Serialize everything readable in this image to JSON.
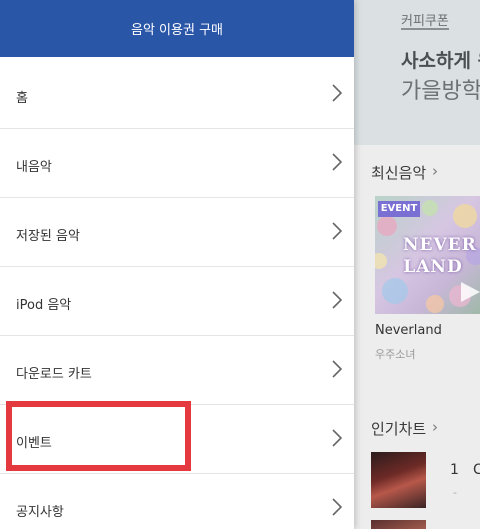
{
  "drawer": {
    "title": "음악 이용권 구매",
    "items": [
      {
        "label": "홈"
      },
      {
        "label": "내음악"
      },
      {
        "label": "저장된 음악"
      },
      {
        "label": "iPod 음악"
      },
      {
        "label": "다운로드 카트"
      },
      {
        "label": "이벤트"
      },
      {
        "label": "공지사항"
      }
    ],
    "highlighted_item": "이벤트",
    "highlight_color": "#e43a3f",
    "header_color": "#2a56a8"
  },
  "background": {
    "coupon_tab": "커피쿠폰",
    "promo_line1": "사소하게 윈",
    "promo_line2": "가을방학",
    "latest_section": "최신음악",
    "event_badge": "EVENT",
    "album_art_text": "NEVER LAND",
    "song_title": "Neverland",
    "song_artist": "우주소녀",
    "chart_section": "인기차트",
    "chart_rank": "1",
    "chart_rank_dash": "-",
    "chart_clip_text": "C"
  }
}
